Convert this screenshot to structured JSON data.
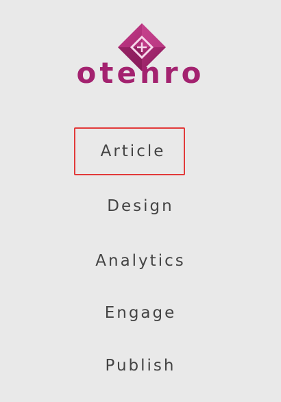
{
  "brand": {
    "name": "otenro",
    "logo_icon": "cube-diamond-icon",
    "color": "#a3226f"
  },
  "nav": {
    "selected_outline_color": "#e23a3a",
    "items": [
      {
        "label": "Article",
        "selected": true
      },
      {
        "label": "Design",
        "selected": false
      },
      {
        "label": "Analytics",
        "selected": false
      },
      {
        "label": "Engage",
        "selected": false
      },
      {
        "label": "Publish",
        "selected": false
      }
    ]
  }
}
